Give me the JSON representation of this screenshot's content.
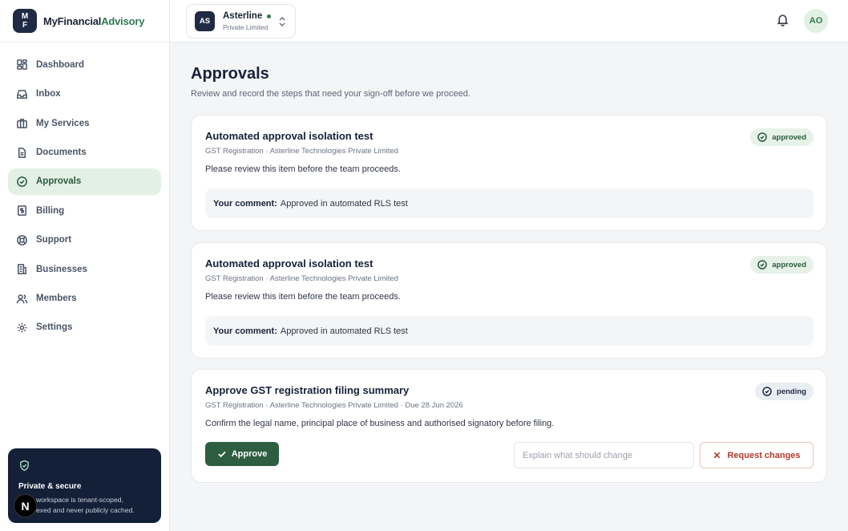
{
  "brand": {
    "logo_top": "M",
    "logo_bottom": "F",
    "name_main": "MyFinancial",
    "name_accent": "Advisory"
  },
  "sidebar": {
    "items": [
      {
        "label": "Dashboard",
        "icon": "dashboard-icon"
      },
      {
        "label": "Inbox",
        "icon": "inbox-icon"
      },
      {
        "label": "My Services",
        "icon": "briefcase-icon"
      },
      {
        "label": "Documents",
        "icon": "document-icon"
      },
      {
        "label": "Approvals",
        "icon": "check-circle-icon",
        "active": true
      },
      {
        "label": "Billing",
        "icon": "dollar-icon"
      },
      {
        "label": "Support",
        "icon": "lifebuoy-icon"
      },
      {
        "label": "Businesses",
        "icon": "building-icon"
      },
      {
        "label": "Members",
        "icon": "users-icon"
      },
      {
        "label": "Settings",
        "icon": "gear-icon"
      }
    ],
    "secure": {
      "title": "Private & secure",
      "text_line1": "workspace is tenant-scoped,",
      "text_line2": "exed and never publicly cached.",
      "badge": "N"
    }
  },
  "topbar": {
    "org": {
      "avatar": "AS",
      "name": "Asterline",
      "sub": "Private Limited"
    },
    "user_initials": "AO"
  },
  "page": {
    "title": "Approvals",
    "subtitle": "Review and record the steps that need your sign-off before we proceed."
  },
  "approvals": [
    {
      "title": "Automated approval isolation test",
      "meta": "GST Registration · Asterline Technologies Private Limited",
      "description": "Please review this item before the team proceeds.",
      "status": "approved",
      "comment_label": "Your comment:",
      "comment": "Approved in automated RLS test"
    },
    {
      "title": "Automated approval isolation test",
      "meta": "GST Registration · Asterline Technologies Private Limited",
      "description": "Please review this item before the team proceeds.",
      "status": "approved",
      "comment_label": "Your comment:",
      "comment": "Approved in automated RLS test"
    },
    {
      "title": "Approve GST registration filing summary",
      "meta": "GST Registration · Asterline Technologies Private Limited · Due 28 Jun 2026",
      "description": "Confirm the legal name, principal place of business and authorised signatory before filing.",
      "status": "pending",
      "approve_label": "Approve",
      "change_placeholder": "Explain what should change",
      "request_label": "Request changes"
    }
  ],
  "colors": {
    "primary": "#2d5e40",
    "navy": "#1f2a44",
    "danger": "#b33a2a",
    "active_bg": "#e3f0e6"
  }
}
